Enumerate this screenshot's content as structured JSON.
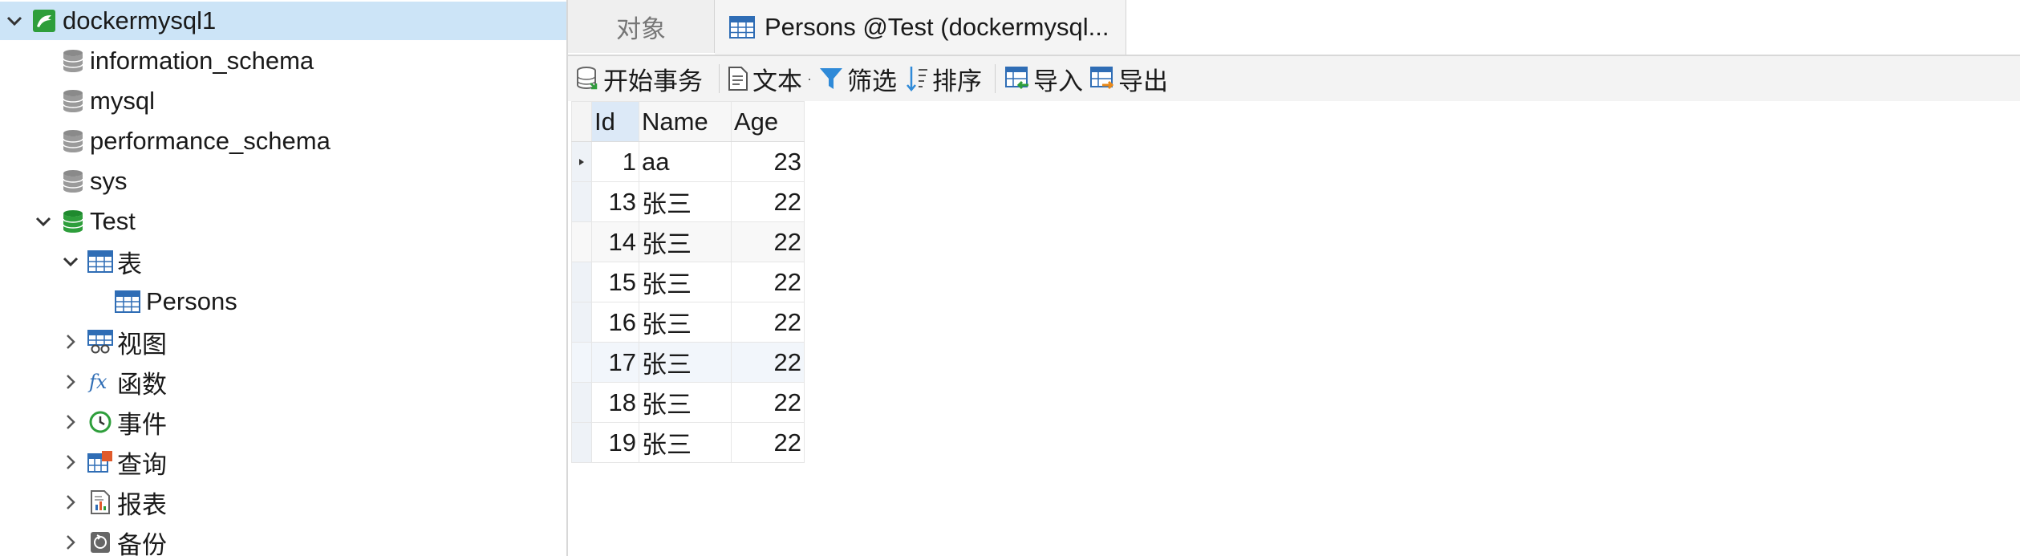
{
  "tree": {
    "connection": "dockermysql1",
    "databases": [
      "information_schema",
      "mysql",
      "performance_schema",
      "sys"
    ],
    "open_db": "Test",
    "tables_folder": "表",
    "table_item": "Persons",
    "folders": [
      "视图",
      "函数",
      "事件",
      "查询",
      "报表",
      "备份"
    ]
  },
  "tabs": {
    "objects": "对象",
    "active": "Persons @Test (dockermysql..."
  },
  "toolbar": {
    "begin_tx": "开始事务",
    "text": "文本",
    "filter": "筛选",
    "sort": "排序",
    "import": "导入",
    "export": "导出"
  },
  "grid": {
    "columns": [
      "Id",
      "Name",
      "Age"
    ],
    "rows": [
      [
        "1",
        "aa",
        "23"
      ],
      [
        "13",
        "张三",
        "22"
      ],
      [
        "14",
        "张三",
        "22"
      ],
      [
        "15",
        "张三",
        "22"
      ],
      [
        "16",
        "张三",
        "22"
      ],
      [
        "17",
        "张三",
        "22"
      ],
      [
        "18",
        "张三",
        "22"
      ],
      [
        "19",
        "张三",
        "22"
      ]
    ]
  },
  "colors": {
    "selection": "#cce4f7",
    "db_active": "#2e9e3b",
    "table_icon": "#2f6db5"
  }
}
